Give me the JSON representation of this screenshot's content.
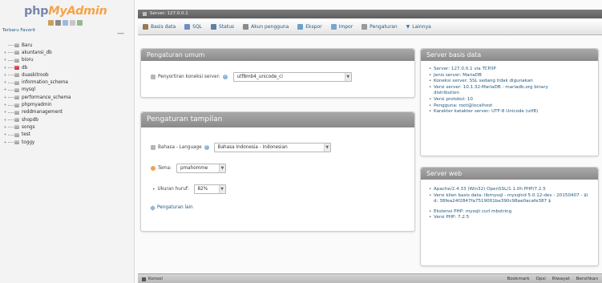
{
  "nav": {
    "logo_part1": "php",
    "logo_part2": "MyAdmin",
    "tabs": "Terbaru  Favorit",
    "databases": [
      {
        "name": "Baru",
        "expand": ""
      },
      {
        "name": "akuntansi_db",
        "expand": "+"
      },
      {
        "name": "bioru",
        "expand": "+"
      },
      {
        "name": "db",
        "expand": "+",
        "highlight": true
      },
      {
        "name": "duaskitroob",
        "expand": "+"
      },
      {
        "name": "information_schema",
        "expand": "+"
      },
      {
        "name": "mysql",
        "expand": "+"
      },
      {
        "name": "performance_schema",
        "expand": "+"
      },
      {
        "name": "phpmyadmin",
        "expand": "+"
      },
      {
        "name": "reddmanagement",
        "expand": "+"
      },
      {
        "name": "shopdb",
        "expand": "+"
      },
      {
        "name": "songs",
        "expand": "+"
      },
      {
        "name": "test",
        "expand": "+"
      },
      {
        "name": "toggy",
        "expand": "+"
      }
    ]
  },
  "topbar": {
    "title": "Server: 127.0.0.1"
  },
  "menu": [
    {
      "label": "Basis data",
      "icon": "database-icon",
      "color": "#9a7b4f"
    },
    {
      "label": "SQL",
      "icon": "sql-icon",
      "color": "#6e8fbf"
    },
    {
      "label": "Status",
      "icon": "status-icon",
      "color": "#5f7fa6"
    },
    {
      "label": "Akun pengguna",
      "icon": "user-accounts-icon",
      "color": "#8a8a8a"
    },
    {
      "label": "Ekspor",
      "icon": "export-icon",
      "color": "#6aa0c9"
    },
    {
      "label": "Impor",
      "icon": "import-icon",
      "color": "#7aa5cf"
    },
    {
      "label": "Pengaturan",
      "icon": "settings-icon",
      "color": "#9a9a9a"
    },
    {
      "label": "Lainnya",
      "icon": "more-icon",
      "color": "#3c7ab0"
    }
  ],
  "general_settings": {
    "title": "Pengaturan umum",
    "collation_label": "Penyortiran koneksi server:",
    "collation_value": "utf8mb4_unicode_ci"
  },
  "appearance_settings": {
    "title": "Pengaturan tampilan",
    "language_label": "Bahasa - Language",
    "language_value": "Bahasa Indonesia - Indonesian",
    "theme_label": "Tema:",
    "theme_value": "pmahomme",
    "fontsize_label": "Ukuran huruf:",
    "fontsize_value": "82%",
    "more_settings": "Pengaturan lain"
  },
  "db_server": {
    "title": "Server basis data",
    "items": [
      "Server: 127.0.0.1 via TCP/IP",
      "Jenis server: MariaDB",
      "Koneksi server: SSL sedang tidak digunakan",
      "Versi server: 10.1.32-MariaDB - mariadb.org binary distribution",
      "Versi protokol: 10",
      "Pengguna: root@localhost",
      "Karakter katakter server: UTF-8 Unicode (utf8)"
    ]
  },
  "web_server": {
    "title": "Server web",
    "items": [
      "Apache/2.4.33 (Win32) OpenSSL/1.1.0h PHP/7.2.5",
      "Versi klien basis data: libmysql - mysqlnd 5.0.12-dev - 20150407 - $Id: 38fea24f2847fa7519001be390c98ae0acafe387 $",
      "Ekstensi PHP: mysqli curl mbstring",
      "Versi PHP: 7.2.5"
    ]
  },
  "console": {
    "label": "Konsol",
    "right": [
      "Bookmark",
      "Opsi",
      "Riwayat",
      "Bersihkan"
    ]
  }
}
